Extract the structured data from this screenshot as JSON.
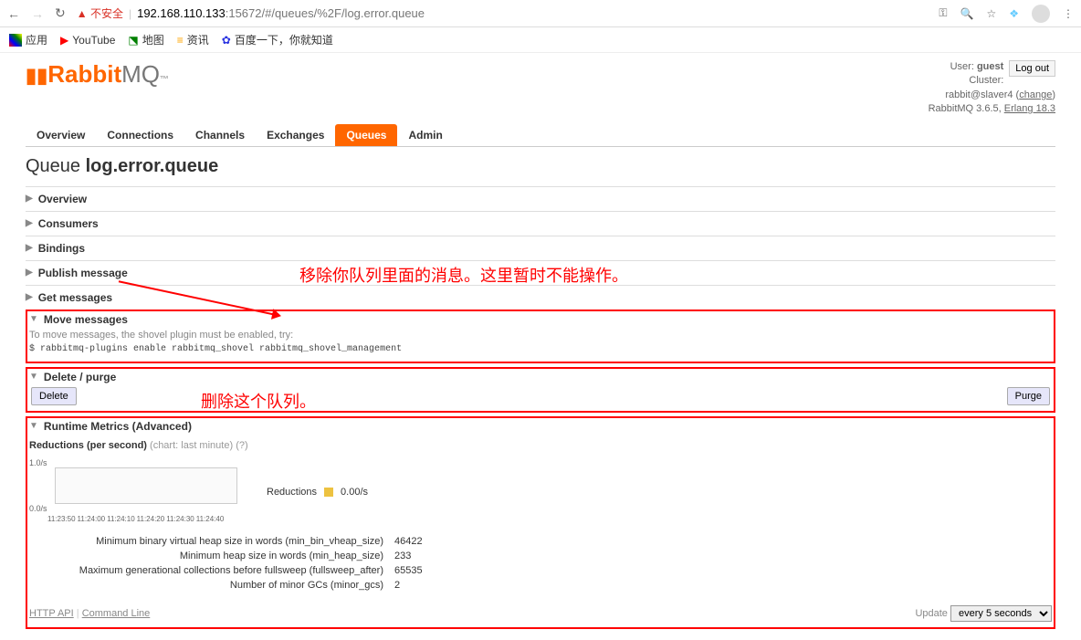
{
  "browser": {
    "insecure_label": "不安全",
    "url_host": "192.168.110.133",
    "url_port": ":15672",
    "url_path": "/#/queues/%2F/log.error.queue"
  },
  "bookmarks": {
    "apps": "应用",
    "youtube": "YouTube",
    "maps": "地图",
    "news": "资讯",
    "baidu": "百度一下，你就知道"
  },
  "logo": {
    "rabbit": "Rabbit",
    "mq": "MQ"
  },
  "user": {
    "label": "User:",
    "name": "guest",
    "cluster_label": "Cluster:",
    "cluster_name": "rabbit@slaver4",
    "change": "change",
    "version": "RabbitMQ 3.6.5,",
    "erlang": "Erlang 18.3",
    "logout": "Log out"
  },
  "tabs": [
    "Overview",
    "Connections",
    "Channels",
    "Exchanges",
    "Queues",
    "Admin"
  ],
  "title": {
    "prefix": "Queue",
    "name": "log.error.queue"
  },
  "sections": {
    "overview": "Overview",
    "consumers": "Consumers",
    "bindings": "Bindings",
    "publish": "Publish message",
    "get": "Get messages",
    "move": "Move messages",
    "delete": "Delete / purge",
    "runtime": "Runtime Metrics (Advanced)"
  },
  "annotations": {
    "move": "移除你队列里面的消息。这里暂时不能操作。",
    "delete": "删除这个队列。"
  },
  "move": {
    "hint": "To move messages, the shovel plugin must be enabled, try:",
    "cmd": "$ rabbitmq-plugins enable rabbitmq_shovel rabbitmq_shovel_management"
  },
  "buttons": {
    "delete": "Delete",
    "purge": "Purge"
  },
  "runtime": {
    "reductions_label": "Reductions (per second)",
    "chart_hint": "(chart: last minute)",
    "q": "(?)",
    "legend_name": "Reductions",
    "legend_val": "0.00/s",
    "y_top": "1.0/s",
    "y_bot": "0.0/s",
    "x_ticks": [
      "11:23:50",
      "11:24:00",
      "11:24:10",
      "11:24:20",
      "11:24:30",
      "11:24:40"
    ],
    "rows": [
      {
        "label": "Minimum binary virtual heap size in words (min_bin_vheap_size)",
        "val": "46422"
      },
      {
        "label": "Minimum heap size in words (min_heap_size)",
        "val": "233"
      },
      {
        "label": "Maximum generational collections before fullsweep (fullsweep_after)",
        "val": "65535"
      },
      {
        "label": "Number of minor GCs (minor_gcs)",
        "val": "2"
      }
    ]
  },
  "chart_data": {
    "type": "line",
    "title": "Reductions (per second)",
    "series": [
      {
        "name": "Reductions",
        "values": [
          0,
          0,
          0,
          0,
          0,
          0
        ]
      }
    ],
    "x": [
      "11:23:50",
      "11:24:00",
      "11:24:10",
      "11:24:20",
      "11:24:30",
      "11:24:40"
    ],
    "ylabel": "/s",
    "ylim": [
      0,
      1
    ]
  },
  "footer": {
    "http_api": "HTTP API",
    "cmd_line": "Command Line",
    "update": "Update",
    "interval": "every 5 seconds"
  }
}
